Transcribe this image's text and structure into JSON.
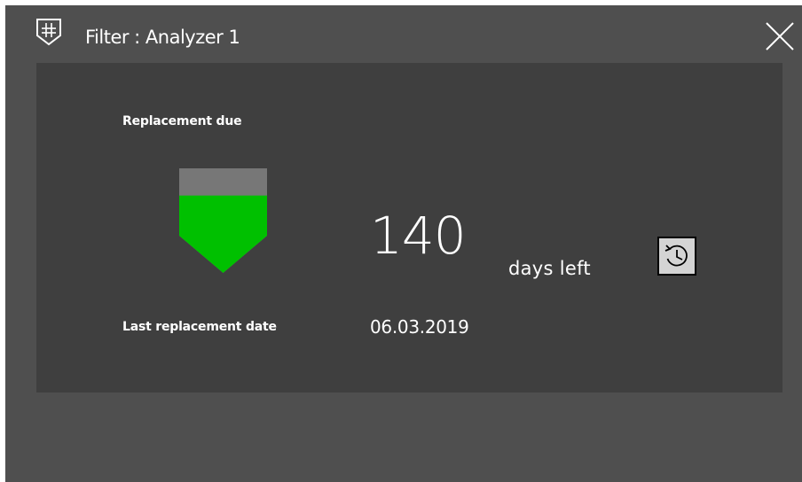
{
  "window": {
    "title": "Filter : Analyzer 1",
    "title_icon": "filter-grid-icon",
    "close_icon": "close-icon"
  },
  "status": {
    "replacement_label": "Replacement due",
    "days_remaining": "140",
    "days_unit": "days left",
    "last_replacement_label": "Last replacement date",
    "last_replacement_date": "06.03.2019",
    "gauge_fill_fraction": 0.74,
    "gauge_fill_color": "#00c000",
    "gauge_empty_color": "#777777",
    "reset_icon": "history-icon"
  }
}
